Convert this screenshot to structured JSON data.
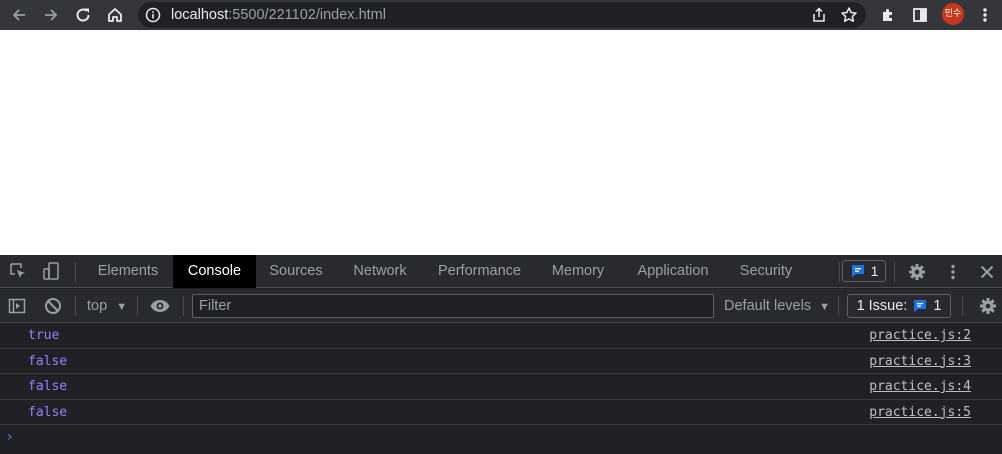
{
  "browser": {
    "url_host": "localhost",
    "url_rest": ":5500/221102/index.html",
    "avatar_text": "민수",
    "icons": [
      "back-icon",
      "forward-icon",
      "reload-icon",
      "home-icon",
      "info-icon",
      "share-icon",
      "star-icon",
      "extensions-icon",
      "sidepanel-icon",
      "menu-icon"
    ]
  },
  "devtools": {
    "tabs": [
      {
        "label": "Elements",
        "active": false
      },
      {
        "label": "Console",
        "active": true
      },
      {
        "label": "Sources",
        "active": false
      },
      {
        "label": "Network",
        "active": false
      },
      {
        "label": "Performance",
        "active": false
      },
      {
        "label": "Memory",
        "active": false
      },
      {
        "label": "Application",
        "active": false
      },
      {
        "label": "Security",
        "active": false
      }
    ],
    "message_count": "1",
    "console_toolbar": {
      "context": "top",
      "filter_placeholder": "Filter",
      "levels": "Default levels",
      "issues_label": "1 Issue:",
      "issues_count": "1"
    },
    "logs": [
      {
        "value": "true",
        "source": "practice.js:2"
      },
      {
        "value": "false",
        "source": "practice.js:3"
      },
      {
        "value": "false",
        "source": "practice.js:4"
      },
      {
        "value": "false",
        "source": "practice.js:5"
      }
    ],
    "prompt_symbol": "›"
  },
  "colors": {
    "toolbar_bg": "#35363a",
    "omnibox_bg": "#202124",
    "devtools_bg": "#202124",
    "active_tab_bg": "#000000",
    "log_value": "#9980ff",
    "accent_blue": "#1a73e8",
    "avatar_bg": "#c5391c"
  }
}
